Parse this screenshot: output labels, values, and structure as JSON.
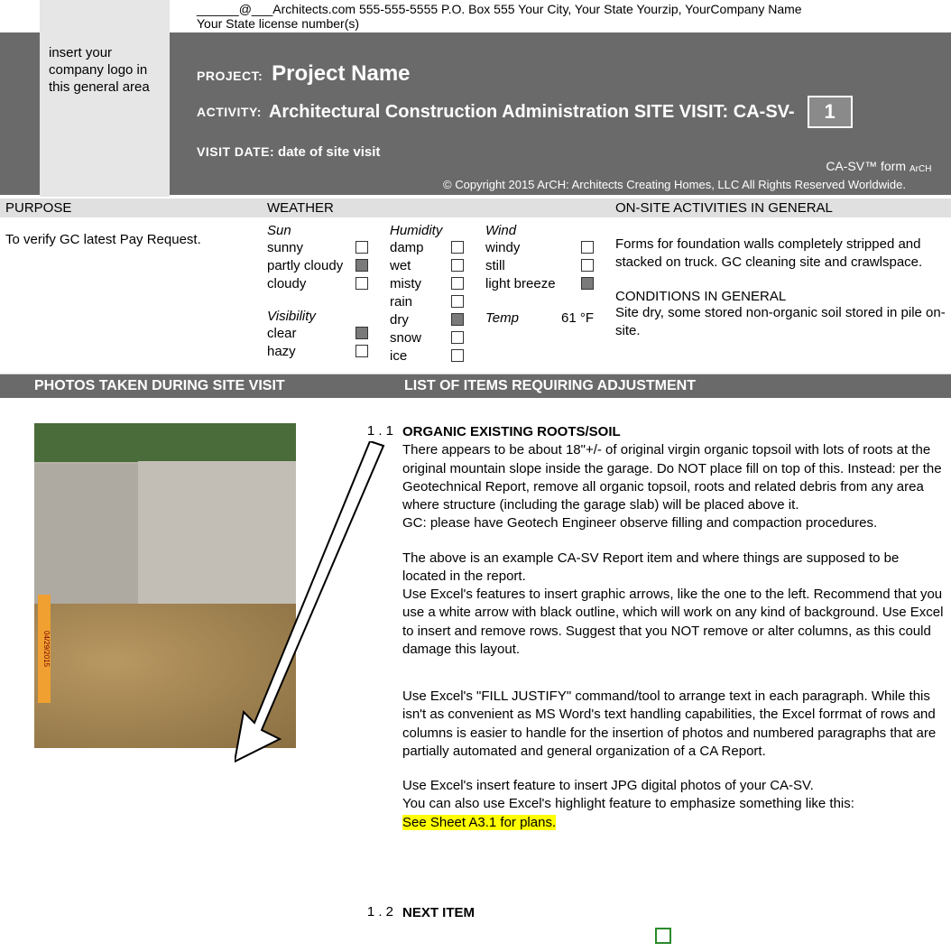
{
  "topInfo": {
    "line1": "______@___Architects.com 555-555-5555 P.O. Box 555 Your City, Your State  Yourzip, YourCompany Name",
    "line2": "Your State license number(s)"
  },
  "logoPlaceholder": "insert your company logo in this general area",
  "header": {
    "projectLabel": "PROJECT:",
    "projectName": "Project Name",
    "activityLabel": "ACTIVITY:",
    "activityName": "Architectural Construction Administration SITE VISIT:  CA-SV-",
    "activityNum": "1",
    "visitDateLabel": "VISIT DATE:",
    "visitDate": "date of site visit",
    "formTag": "CA-SV™ form",
    "copyright": "© Copyright 2015 ArCH: Architects Creating Homes, LLC All Rights Reserved Worldwide.",
    "archLogo": "ArCH"
  },
  "purpose": {
    "heading": "PURPOSE",
    "text": "To verify GC latest Pay Request."
  },
  "weather": {
    "heading": "WEATHER",
    "sunHead": "Sun",
    "sun": [
      {
        "label": "sunny",
        "checked": false
      },
      {
        "label": "partly cloudy",
        "checked": true
      },
      {
        "label": "cloudy",
        "checked": false
      }
    ],
    "visHead": "Visibility",
    "vis": [
      {
        "label": "clear",
        "checked": true
      },
      {
        "label": "hazy",
        "checked": false
      }
    ],
    "humHead": "Humidity",
    "hum": [
      {
        "label": "damp",
        "checked": false
      },
      {
        "label": "wet",
        "checked": false
      },
      {
        "label": "misty",
        "checked": false
      },
      {
        "label": "rain",
        "checked": false
      },
      {
        "label": "dry",
        "checked": true
      },
      {
        "label": "snow",
        "checked": false
      },
      {
        "label": "ice",
        "checked": false
      }
    ],
    "windHead": "Wind",
    "wind": [
      {
        "label": "windy",
        "checked": false
      },
      {
        "label": "still",
        "checked": false
      },
      {
        "label": "light breeze",
        "checked": true
      }
    ],
    "tempLabel": "Temp",
    "tempVal": "61 °F"
  },
  "onsite": {
    "heading": "ON-SITE ACTIVITIES IN GENERAL",
    "text": "Forms for foundation walls completely stripped and stacked on truck. GC cleaning site and crawlspace.",
    "condHead": "CONDITIONS IN GENERAL",
    "condText": "Site dry, some stored non-organic soil stored in pile on-site."
  },
  "darkRow": {
    "left": "PHOTOS TAKEN DURING SITE VISIT",
    "right": "LIST OF ITEMS REQUIRING ADJUSTMENT"
  },
  "items": {
    "i1": {
      "num": "1 .  1",
      "title": "ORGANIC EXISTING ROOTS/SOIL",
      "p1": "There appears to be about 18\"+/- of original virgin organic topsoil with lots of roots at the original mountain slope inside the garage.  Do NOT place fill on top of this.  Instead: per the Geotechnical Report, remove all organic topsoil, roots and related debris from any area where structure (including the garage slab) will be placed above it.",
      "p1b": "GC: please have Geotech Engineer observe filling and compaction procedures.",
      "p2": "The above is an example CA-SV Report item and where things are supposed to be located in the report.",
      "p2b": "Use Excel's features to insert graphic arrows, like the one to the left.  Recommend  that you use a white arrow with black outline, which will work on any kind of background. Use Excel to insert and remove rows.  Suggest that you NOT remove or alter columns, as this could damage this layout.",
      "p3": "Use Excel's \"FILL JUSTIFY\" command/tool to arrange text in each paragraph. While this isn't as convenient as MS Word's text handling capabilities, the Excel forrmat of rows and columns is easier to handle for the insertion of photos and numbered paragraphs that are partially automated and general organization of a CA Report.",
      "p4": "Use Excel's insert feature to insert JPG digital photos of your CA-SV.",
      "p4b": "You can also use Excel's highlight feature to emphasize something like this:",
      "p4c": "See Sheet A3.1 for plans."
    },
    "i2": {
      "num": "1 .  2",
      "title": "NEXT ITEM"
    }
  }
}
